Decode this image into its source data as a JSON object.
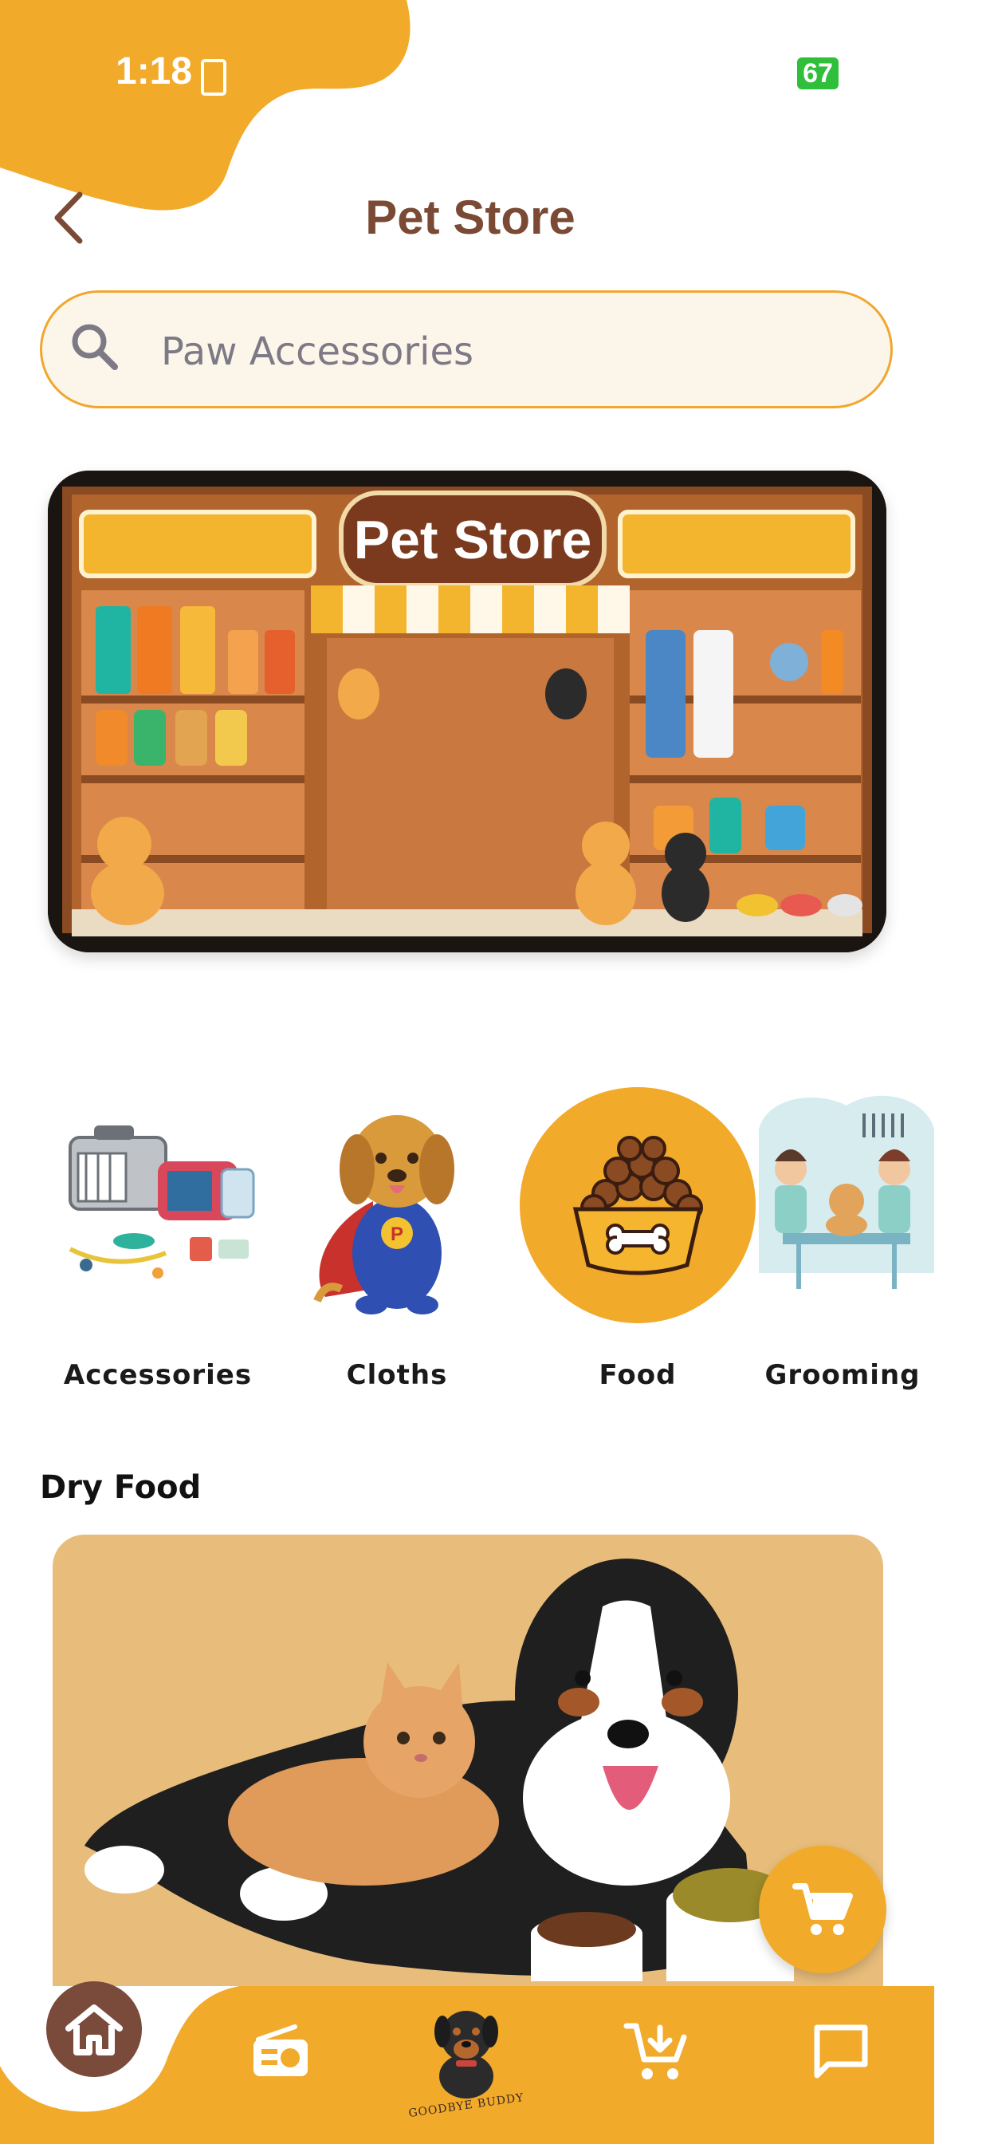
{
  "status_bar": {
    "time": "1:18",
    "battery": "67"
  },
  "header": {
    "title": "Pet Store"
  },
  "search": {
    "placeholder": "Paw Accessories"
  },
  "banner": {
    "sign_text": "Pet Store"
  },
  "categories": [
    {
      "label": "Accessories",
      "icon": "pet-carrier-accessories-icon",
      "selected": false
    },
    {
      "label": "Cloths",
      "icon": "superhero-dog-costume-icon",
      "selected": false
    },
    {
      "label": "Food",
      "icon": "food-bowl-icon",
      "selected": true
    },
    {
      "label": "Grooming",
      "icon": "grooming-salon-icon",
      "selected": false
    }
  ],
  "section": {
    "title": "Dry Food"
  },
  "bottom_nav": {
    "brand_text": "GOODBYE BUDDY",
    "items": [
      "home-icon",
      "radio-icon",
      "brand-dog-logo",
      "cart-download-icon",
      "chat-icon"
    ]
  },
  "colors": {
    "accent": "#f2aa2a",
    "brown": "#7a4a34",
    "card_bg": "#e8bd7b",
    "search_bg": "#fcf6ea"
  }
}
